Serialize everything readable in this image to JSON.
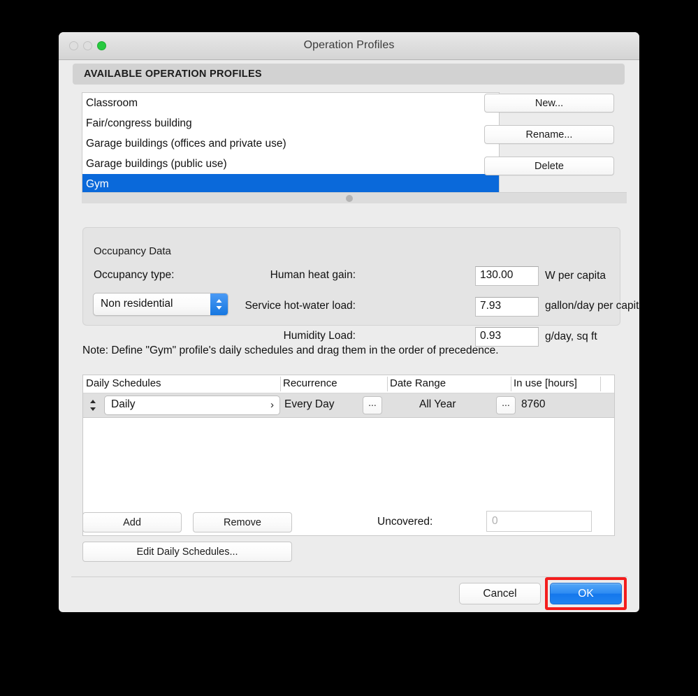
{
  "window": {
    "title": "Operation Profiles",
    "traffic_lights": {
      "close": "close-button",
      "minimize": "minimize-button",
      "zoom": "zoom-button"
    }
  },
  "section": {
    "header": "AVAILABLE OPERATION PROFILES"
  },
  "profiles": {
    "items": [
      {
        "label": "Classroom",
        "selected": false
      },
      {
        "label": "Fair/congress building",
        "selected": false
      },
      {
        "label": "Garage buildings (offices and private use)",
        "selected": false
      },
      {
        "label": "Garage buildings (public use)",
        "selected": false
      },
      {
        "label": "Gym",
        "selected": true
      }
    ],
    "selected_label": "Gym",
    "selection_color": "#0a69da"
  },
  "side_buttons": {
    "new": "New...",
    "rename": "Rename...",
    "delete": "Delete"
  },
  "occupancy": {
    "group_label": "Occupancy Data",
    "type_label": "Occupancy type:",
    "type_value": "Non residential",
    "fields": [
      {
        "label": "Human heat gain:",
        "value": "130.00",
        "unit": "W per capita"
      },
      {
        "label": "Service hot-water load:",
        "value": "7.93",
        "unit": "gallon/day per capita"
      },
      {
        "label": "Humidity Load:",
        "value": "0.93",
        "unit": "g/day, sq ft"
      }
    ]
  },
  "note": "Note: Define \"Gym\" profile's daily schedules and drag them in the order of precedence.",
  "schedules": {
    "columns": [
      "Daily Schedules",
      "Recurrence",
      "Date Range",
      "In use [hours]"
    ],
    "rows": [
      {
        "daily_schedule": "Daily",
        "recurrence": "Every Day",
        "recurrence_more": "...",
        "date_range": "All Year",
        "date_range_more": "...",
        "in_use_hours": "8760"
      }
    ]
  },
  "bottom_buttons": {
    "add": "Add",
    "remove": "Remove",
    "edit": "Edit Daily Schedules..."
  },
  "uncovered": {
    "label": "Uncovered:",
    "value": "0"
  },
  "footer": {
    "cancel": "Cancel",
    "ok": "OK",
    "ok_highlight_color": "#f41d1d",
    "ok_accent_color": "#2083f0"
  }
}
